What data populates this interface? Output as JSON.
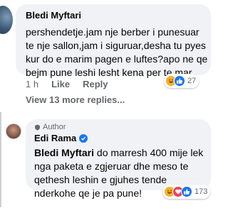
{
  "top_comment": {
    "author": "Bledi Myftari",
    "text": "pershendetje.jam nje berber i punesuar te nje sallon,jam i siguruar,desha tu pyes kur do e marim pagen e luftes?apo ne qe bejm pune leshi lesht kena per te mar.",
    "time": "1 h",
    "like_label": "Like",
    "reply_label": "Reply",
    "reaction_count": "27",
    "reactions": [
      "haha-icon",
      "like-icon"
    ]
  },
  "view_more": "View 13 more replies...",
  "reply": {
    "badge": "Author",
    "author": "Edi Rama",
    "mention": "Bledi Myftari",
    "text": " do marresh 400 mije lek nga paketa  e zgjeruar dhe meso te qethesh leshin e gjuhes tende nderkohe qe je pa pune!",
    "reaction_count": "173",
    "reactions": [
      "haha-icon",
      "love-icon",
      "like-icon"
    ]
  },
  "colors": {
    "bubble": "#f0f2f5",
    "meta_text": "#65676b",
    "verified": "#1877f2",
    "like": "#1877f2",
    "haha": "#f7b125",
    "love": "#f33e58"
  }
}
